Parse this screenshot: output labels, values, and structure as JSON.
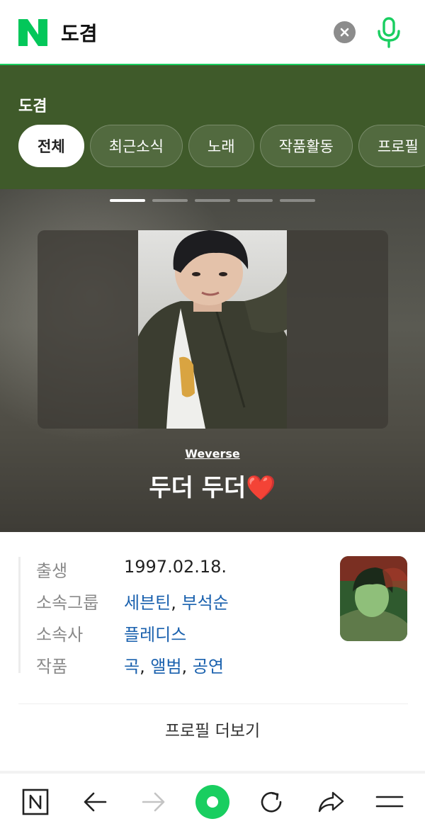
{
  "search": {
    "query": "도겸"
  },
  "panel": {
    "title": "도겸",
    "tabs": [
      {
        "label": "전체",
        "active": true
      },
      {
        "label": "최근소식"
      },
      {
        "label": "노래"
      },
      {
        "label": "작품활동"
      },
      {
        "label": "프로필"
      }
    ]
  },
  "hero": {
    "slide_count": 5,
    "active_slide": 1,
    "source": "Weverse",
    "caption": "두더 두더❤️"
  },
  "profile": {
    "birth": {
      "label": "출생",
      "value": "1997.02.18."
    },
    "group": {
      "label": "소속그룹",
      "links": [
        "세븐틴",
        "부석순"
      ]
    },
    "agency": {
      "label": "소속사",
      "links": [
        "플레디스"
      ]
    },
    "works": {
      "label": "작품",
      "links": [
        "곡",
        "앨범",
        "공연"
      ]
    },
    "more_label": "프로필 더보기"
  },
  "toolbar": {
    "icons": [
      "naver-home-icon",
      "back-arrow-icon",
      "forward-arrow-icon",
      "green-dot-icon",
      "refresh-icon",
      "share-icon",
      "menu-icon"
    ]
  },
  "colors": {
    "accent": "#19ce60",
    "panel": "#3f5a2a",
    "link": "#1a61ae"
  }
}
